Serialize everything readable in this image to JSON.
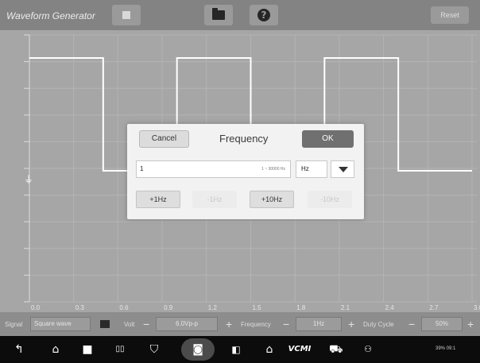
{
  "titlebar": {
    "title": "Waveform Generator",
    "reset_label": "Reset",
    "stop_icon": "stop-icon",
    "folder_icon": "folder-icon",
    "help_icon": "help-icon"
  },
  "plot": {
    "y_ticks": [
      "",
      "",
      "",
      "",
      "",
      "",
      "",
      "",
      "",
      "",
      ""
    ],
    "x_ticks": [
      "0.0",
      "0.3",
      "0.6",
      "0.9",
      "1.2",
      "1.5",
      "1.8",
      "2.1",
      "2.4",
      "2.7",
      "3.0s"
    ]
  },
  "controls": {
    "signal_label": "Signal",
    "signal_value": "Square wave",
    "volt_label": "Volt",
    "volt_value": "6.0Vp-p",
    "frequency_label": "Frequency",
    "frequency_value": "1Hz",
    "duty_label": "Duty Cycle",
    "duty_value": "50%",
    "minus": "−",
    "plus": "+"
  },
  "dialog": {
    "cancel_label": "Cancel",
    "title": "Frequency",
    "ok_label": "OK",
    "input_value": "1",
    "input_range": "1 ~ 30000 Hz",
    "unit_value": "Hz",
    "step_buttons": [
      {
        "label": "+1Hz",
        "enabled": true
      },
      {
        "label": "-1Hz",
        "enabled": false
      },
      {
        "label": "+10Hz",
        "enabled": true
      },
      {
        "label": "-10Hz",
        "enabled": false
      }
    ]
  },
  "navbar": {
    "vcmi_label": "VCMI",
    "status_text": "39% 09:1"
  },
  "colors": {
    "plot_bg": "#a6a6a6",
    "dialog_bg": "#f2f2f2",
    "ok_bg": "#707070",
    "navbar_bg": "#0c0c0c"
  }
}
